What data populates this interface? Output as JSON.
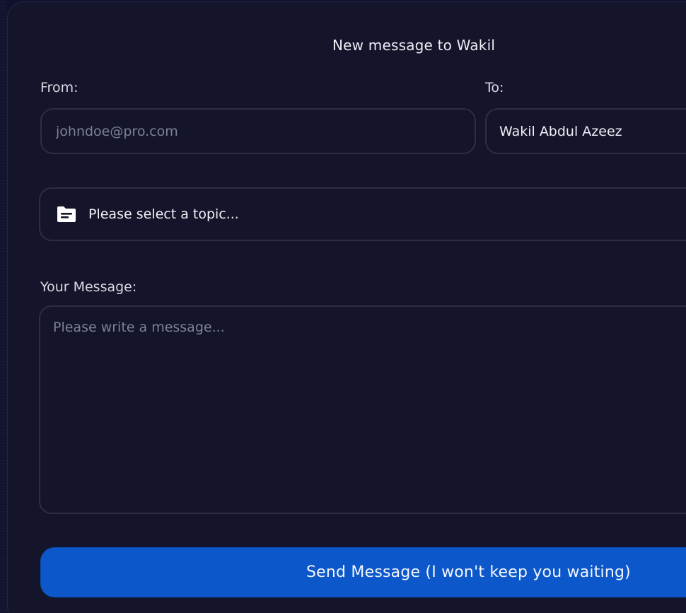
{
  "form": {
    "title": "New message to Wakil",
    "from_label": "From:",
    "from_placeholder": "johndoe@pro.com",
    "to_label": "To:",
    "to_value": "Wakil Abdul Azeez",
    "topic_placeholder": "Please select a topic...",
    "topic_icon": "document-icon",
    "message_label": "Your Message:",
    "message_placeholder": "Please write a message...",
    "send_label": "Send Message (I won't keep you waiting)"
  },
  "colors": {
    "background": "#14152a",
    "border": "#2d2e44",
    "accent": "#0c57c9"
  }
}
